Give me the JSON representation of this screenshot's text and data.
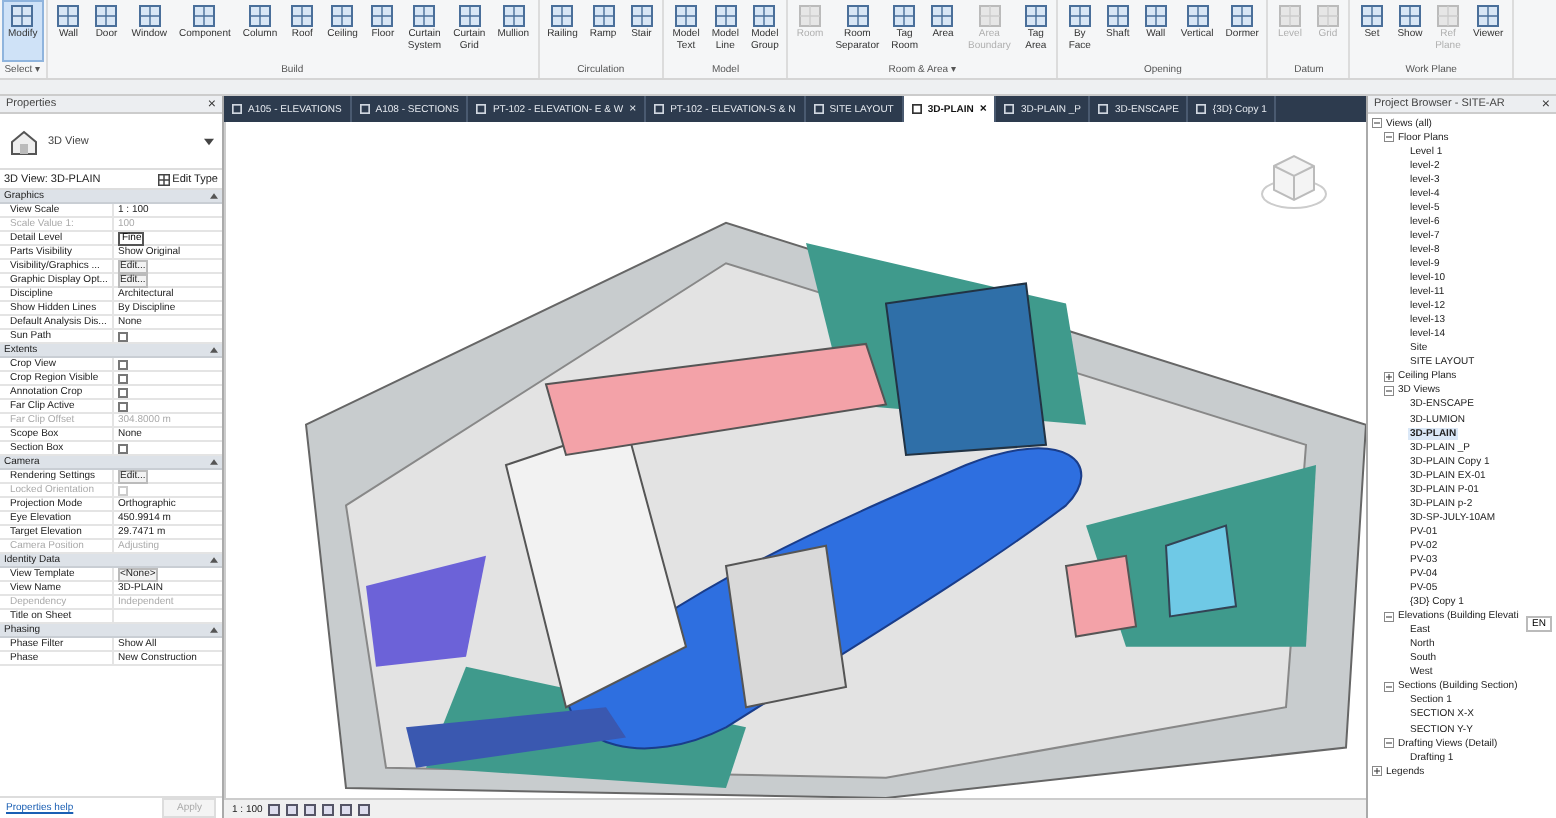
{
  "ribbon": {
    "panels": [
      {
        "title": "Select ▾",
        "tools": [
          {
            "label": "Modify",
            "selected": true,
            "disabled": false
          }
        ]
      },
      {
        "title": "Build",
        "tools": [
          {
            "label": "Wall",
            "selected": false,
            "disabled": false
          },
          {
            "label": "Door",
            "selected": false,
            "disabled": false
          },
          {
            "label": "Window",
            "selected": false,
            "disabled": false
          },
          {
            "label": "Component",
            "selected": false,
            "disabled": false
          },
          {
            "label": "Column",
            "selected": false,
            "disabled": false
          },
          {
            "label": "Roof",
            "selected": false,
            "disabled": false
          },
          {
            "label": "Ceiling",
            "selected": false,
            "disabled": false
          },
          {
            "label": "Floor",
            "selected": false,
            "disabled": false
          },
          {
            "label": "Curtain System",
            "selected": false,
            "disabled": false
          },
          {
            "label": "Curtain Grid",
            "selected": false,
            "disabled": false
          },
          {
            "label": "Mullion",
            "selected": false,
            "disabled": false
          }
        ]
      },
      {
        "title": "Circulation",
        "tools": [
          {
            "label": "Railing",
            "selected": false,
            "disabled": false
          },
          {
            "label": "Ramp",
            "selected": false,
            "disabled": false
          },
          {
            "label": "Stair",
            "selected": false,
            "disabled": false
          }
        ]
      },
      {
        "title": "Model",
        "tools": [
          {
            "label": "Model Text",
            "selected": false,
            "disabled": false
          },
          {
            "label": "Model Line",
            "selected": false,
            "disabled": false
          },
          {
            "label": "Model Group",
            "selected": false,
            "disabled": false
          }
        ]
      },
      {
        "title": "Room & Area ▾",
        "tools": [
          {
            "label": "Room",
            "selected": false,
            "disabled": true
          },
          {
            "label": "Room Separator",
            "selected": false,
            "disabled": false
          },
          {
            "label": "Tag Room",
            "selected": false,
            "disabled": false
          },
          {
            "label": "Area",
            "selected": false,
            "disabled": false
          },
          {
            "label": "Area Boundary",
            "selected": false,
            "disabled": true
          },
          {
            "label": "Tag Area",
            "selected": false,
            "disabled": false
          }
        ]
      },
      {
        "title": "Opening",
        "tools": [
          {
            "label": "By Face",
            "selected": false,
            "disabled": false
          },
          {
            "label": "Shaft",
            "selected": false,
            "disabled": false
          },
          {
            "label": "Wall",
            "selected": false,
            "disabled": false
          },
          {
            "label": "Vertical",
            "selected": false,
            "disabled": false
          },
          {
            "label": "Dormer",
            "selected": false,
            "disabled": false
          }
        ]
      },
      {
        "title": "Datum",
        "tools": [
          {
            "label": "Level",
            "selected": false,
            "disabled": true
          },
          {
            "label": "Grid",
            "selected": false,
            "disabled": true
          }
        ]
      },
      {
        "title": "Work Plane",
        "tools": [
          {
            "label": "Set",
            "selected": false,
            "disabled": false
          },
          {
            "label": "Show",
            "selected": false,
            "disabled": false
          },
          {
            "label": "Ref Plane",
            "selected": false,
            "disabled": true
          },
          {
            "label": "Viewer",
            "selected": false,
            "disabled": false
          }
        ]
      }
    ]
  },
  "properties": {
    "title": "Properties",
    "close": "×",
    "type_name": "3D View",
    "view_selector": "3D View: 3D-PLAIN",
    "edit_type": "Edit Type",
    "groups": [
      {
        "title": "Graphics",
        "rows": [
          {
            "name": "View Scale",
            "value": "1 : 100",
            "kind": "text",
            "disabled": false
          },
          {
            "name": "Scale Value    1:",
            "value": "100",
            "kind": "text",
            "disabled": true
          },
          {
            "name": "Detail Level",
            "value": "Fine",
            "kind": "field",
            "disabled": false
          },
          {
            "name": "Parts Visibility",
            "value": "Show Original",
            "kind": "text",
            "disabled": false
          },
          {
            "name": "Visibility/Graphics ...",
            "value": "Edit...",
            "kind": "button",
            "disabled": false
          },
          {
            "name": "Graphic Display Opt...",
            "value": "Edit...",
            "kind": "button",
            "disabled": false
          },
          {
            "name": "Discipline",
            "value": "Architectural",
            "kind": "text",
            "disabled": false
          },
          {
            "name": "Show Hidden Lines",
            "value": "By Discipline",
            "kind": "text",
            "disabled": false
          },
          {
            "name": "Default Analysis Dis...",
            "value": "None",
            "kind": "text",
            "disabled": false
          },
          {
            "name": "Sun Path",
            "kind": "checkbox",
            "checked": false,
            "disabled": false
          }
        ]
      },
      {
        "title": "Extents",
        "rows": [
          {
            "name": "Crop View",
            "kind": "checkbox",
            "checked": false,
            "disabled": false
          },
          {
            "name": "Crop Region Visible",
            "kind": "checkbox",
            "checked": false,
            "disabled": false
          },
          {
            "name": "Annotation Crop",
            "kind": "checkbox",
            "checked": false,
            "disabled": false
          },
          {
            "name": "Far Clip Active",
            "kind": "checkbox",
            "checked": false,
            "disabled": false
          },
          {
            "name": "Far Clip Offset",
            "value": "304.8000 m",
            "kind": "text",
            "disabled": true
          },
          {
            "name": "Scope Box",
            "value": "None",
            "kind": "text",
            "disabled": false
          },
          {
            "name": "Section Box",
            "kind": "checkbox",
            "checked": false,
            "disabled": false
          }
        ]
      },
      {
        "title": "Camera",
        "rows": [
          {
            "name": "Rendering Settings",
            "value": "Edit...",
            "kind": "button",
            "disabled": false
          },
          {
            "name": "Locked Orientation",
            "kind": "checkbox",
            "checked": false,
            "disabled": true
          },
          {
            "name": "Projection Mode",
            "value": "Orthographic",
            "kind": "text",
            "disabled": false
          },
          {
            "name": "Eye Elevation",
            "value": "450.9914 m",
            "kind": "text",
            "disabled": false
          },
          {
            "name": "Target Elevation",
            "value": "29.7471 m",
            "kind": "text",
            "disabled": false
          },
          {
            "name": "Camera Position",
            "value": "Adjusting",
            "kind": "text",
            "disabled": true
          }
        ]
      },
      {
        "title": "Identity Data",
        "rows": [
          {
            "name": "View Template",
            "value": "<None>",
            "kind": "button",
            "disabled": false
          },
          {
            "name": "View Name",
            "value": "3D-PLAIN",
            "kind": "text",
            "disabled": false
          },
          {
            "name": "Dependency",
            "value": "Independent",
            "kind": "text",
            "disabled": true
          },
          {
            "name": "Title on Sheet",
            "kind": "text",
            "disabled": false
          }
        ]
      },
      {
        "title": "Phasing",
        "rows": [
          {
            "name": "Phase Filter",
            "value": "Show All",
            "kind": "text",
            "disabled": false
          },
          {
            "name": "Phase",
            "value": "New Construction",
            "kind": "text",
            "disabled": false
          }
        ]
      }
    ],
    "help_link": "Properties help",
    "apply": "Apply"
  },
  "tabs": [
    {
      "label": "A105 - ELEVATIONS",
      "selected": false,
      "closable": false
    },
    {
      "label": "A108 - SECTIONS",
      "selected": false,
      "closable": false
    },
    {
      "label": "PT-102 - ELEVATION- E & W",
      "selected": false,
      "closable": true
    },
    {
      "label": "PT-102 - ELEVATION-S & N",
      "selected": false,
      "closable": false
    },
    {
      "label": "SITE LAYOUT",
      "selected": false,
      "closable": false
    },
    {
      "label": "3D-PLAIN",
      "selected": true,
      "closable": true
    },
    {
      "label": "3D-PLAIN _P",
      "selected": false,
      "closable": false
    },
    {
      "label": "3D-ENSCAPE",
      "selected": false,
      "closable": false
    },
    {
      "label": "{3D} Copy 1",
      "selected": false,
      "closable": false
    }
  ],
  "tab_close": "×",
  "view_scale": "1 : 100",
  "browser": {
    "title": "Project Browser - SITE-AR",
    "close": "×",
    "language_indicator": "EN",
    "tree": [
      {
        "label": "Views (all)",
        "expanded": true,
        "children": [
          {
            "label": "Floor Plans",
            "expanded": true,
            "children": [
              {
                "label": "Level 1",
                "selected": false
              },
              {
                "label": "level-2",
                "selected": false
              },
              {
                "label": "level-3",
                "selected": false
              },
              {
                "label": "level-4",
                "selected": false
              },
              {
                "label": "level-5",
                "selected": false
              },
              {
                "label": "level-6",
                "selected": false
              },
              {
                "label": "level-7",
                "selected": false
              },
              {
                "label": "level-8",
                "selected": false
              },
              {
                "label": "level-9",
                "selected": false
              },
              {
                "label": "level-10",
                "selected": false
              },
              {
                "label": "level-11",
                "selected": false
              },
              {
                "label": "level-12",
                "selected": false
              },
              {
                "label": "level-13",
                "selected": false
              },
              {
                "label": "level-14",
                "selected": false
              },
              {
                "label": "Site",
                "selected": false
              },
              {
                "label": "SITE LAYOUT",
                "selected": false
              }
            ]
          },
          {
            "label": "Ceiling Plans",
            "expanded": false
          },
          {
            "label": "3D Views",
            "expanded": true,
            "children": [
              {
                "label": "3D-ENSCAPE",
                "selected": false
              },
              {
                "label": "3D-LUMION",
                "selected": false
              },
              {
                "label": "3D-PLAIN",
                "selected": true
              },
              {
                "label": "3D-PLAIN _P",
                "selected": false
              },
              {
                "label": "3D-PLAIN Copy 1",
                "selected": false
              },
              {
                "label": "3D-PLAIN EX-01",
                "selected": false
              },
              {
                "label": "3D-PLAIN P-01",
                "selected": false
              },
              {
                "label": "3D-PLAIN p-2",
                "selected": false
              },
              {
                "label": "3D-SP-JULY-10AM",
                "selected": false
              },
              {
                "label": "PV-01",
                "selected": false
              },
              {
                "label": "PV-02",
                "selected": false
              },
              {
                "label": "PV-03",
                "selected": false
              },
              {
                "label": "PV-04",
                "selected": false
              },
              {
                "label": "PV-05",
                "selected": false
              },
              {
                "label": "{3D} Copy 1",
                "selected": false
              }
            ]
          },
          {
            "label": "Elevations (Building Elevati",
            "expanded": true,
            "children": [
              {
                "label": "East",
                "selected": false
              },
              {
                "label": "North",
                "selected": false
              },
              {
                "label": "South",
                "selected": false
              },
              {
                "label": "West",
                "selected": false
              }
            ]
          },
          {
            "label": "Sections (Building Section)",
            "expanded": true,
            "children": [
              {
                "label": "Section 1",
                "selected": false
              },
              {
                "label": "SECTION X-X",
                "selected": false
              },
              {
                "label": "SECTION Y-Y",
                "selected": false
              }
            ]
          },
          {
            "label": "Drafting Views (Detail)",
            "expanded": true,
            "children": [
              {
                "label": "Drafting 1",
                "selected": false
              }
            ]
          }
        ]
      },
      {
        "label": "Legends",
        "expanded": false
      }
    ]
  }
}
